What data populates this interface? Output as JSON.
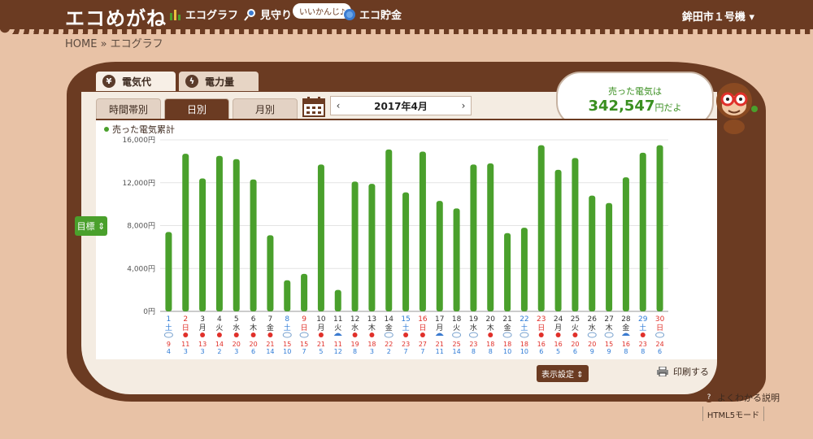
{
  "header": {
    "logo": "エコめがね",
    "nav": [
      {
        "label": "エコグラフ",
        "icon": "bar-chart-icon"
      },
      {
        "label": "見守り",
        "icon": "magnifier-icon"
      },
      {
        "label": "エコ貯金",
        "icon": "piggy-bank-icon"
      }
    ],
    "watch_badge": "いいかんじ♪",
    "device": "鉾田市１号機"
  },
  "breadcrumb": "HOME » エコグラフ",
  "tabs": [
    {
      "label": "電気代",
      "icon": "yen-icon"
    },
    {
      "label": "電力量",
      "icon": "lightning-icon"
    }
  ],
  "subtabs": [
    "時間帯別",
    "日別",
    "月別"
  ],
  "month_label": "2017年4月",
  "speech": {
    "line1": "売った電気は",
    "amount": "342,547",
    "suffix": "円だよ"
  },
  "target_button": "目標",
  "settings_button": "表示設定",
  "print_label": "印刷する",
  "help_label": "よくわかる説明",
  "html5_label": "HTML5モード",
  "chart_data": {
    "type": "bar",
    "title": "売った電気累計",
    "ylim": [
      0,
      16000
    ],
    "yticks": [
      "0円",
      "4,000円",
      "8,000円",
      "12,000円",
      "16,000円"
    ],
    "series_color": "#4aa02c",
    "days": [
      "1",
      "2",
      "3",
      "4",
      "5",
      "6",
      "7",
      "8",
      "9",
      "10",
      "11",
      "12",
      "13",
      "14",
      "15",
      "16",
      "17",
      "18",
      "19",
      "20",
      "21",
      "22",
      "23",
      "24",
      "25",
      "26",
      "27",
      "28",
      "29",
      "30"
    ],
    "weekdays": [
      "土",
      "日",
      "月",
      "火",
      "水",
      "木",
      "金",
      "土",
      "日",
      "月",
      "火",
      "水",
      "木",
      "金",
      "土",
      "日",
      "月",
      "火",
      "水",
      "木",
      "金",
      "土",
      "日",
      "月",
      "火",
      "水",
      "木",
      "金",
      "土",
      "日"
    ],
    "values": [
      7400,
      14700,
      12400,
      14500,
      14200,
      12300,
      7100,
      2900,
      3500,
      13700,
      2000,
      12100,
      11900,
      15100,
      11100,
      14900,
      10300,
      9600,
      13700,
      13800,
      7300,
      7800,
      15500,
      13200,
      14300,
      10800,
      10100,
      12500,
      14800,
      15500
    ],
    "weather": [
      "cloud",
      "sun",
      "sun",
      "sun",
      "sun",
      "sun",
      "sun",
      "cloud",
      "cloud",
      "sun",
      "umbrella",
      "sun",
      "sun",
      "cloud",
      "sun",
      "sun",
      "umbrella",
      "cloud",
      "cloud",
      "sun",
      "cloud",
      "cloud",
      "sun",
      "sun",
      "sun",
      "cloud",
      "cloud",
      "umbrella",
      "sun",
      "cloud"
    ],
    "temp_high": [
      "9",
      "11",
      "13",
      "14",
      "20",
      "20",
      "21",
      "15",
      "15",
      "21",
      "11",
      "19",
      "18",
      "22",
      "23",
      "27",
      "21",
      "25",
      "23",
      "18",
      "18",
      "18",
      "16",
      "16",
      "20",
      "20",
      "15",
      "16",
      "23",
      "24"
    ],
    "temp_low": [
      "4",
      "3",
      "3",
      "2",
      "3",
      "6",
      "14",
      "10",
      "7",
      "5",
      "12",
      "8",
      "3",
      "2",
      "7",
      "7",
      "11",
      "14",
      "8",
      "8",
      "10",
      "10",
      "6",
      "5",
      "6",
      "9",
      "9",
      "8",
      "8",
      "6"
    ]
  }
}
